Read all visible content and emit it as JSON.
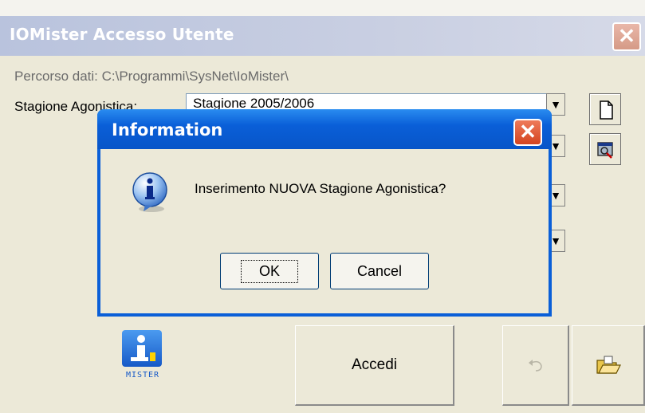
{
  "window": {
    "title": "IOMister Accesso Utente",
    "close_glyph": "✕"
  },
  "form": {
    "path_label": "Percorso dati: C:\\Programmi\\SysNet\\IoMister\\",
    "season_label": "Stagione Agonistica:",
    "season_value": "Stagione 2005/2006",
    "combo_arrow": "▼"
  },
  "buttons": {
    "access_label": "Accedi"
  },
  "logo": {
    "letter": "i",
    "text": "MISTER"
  },
  "dialog": {
    "title": "Information",
    "close_glyph": "✕",
    "message": "Inserimento NUOVA Stagione Agonistica?",
    "ok_label": "OK",
    "cancel_label": "Cancel",
    "icon": "information-icon"
  },
  "colors": {
    "dialog_titlebar": "#0a5fd8",
    "window_background": "#ece9d8",
    "inactive_titlebar": "#c9cfe2"
  }
}
